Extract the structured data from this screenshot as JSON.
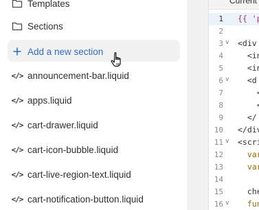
{
  "tree": {
    "templates_label": "Templates",
    "sections_label": "Sections",
    "add_section_label": "Add a new section",
    "file_icon_glyph": "</>",
    "files": [
      "announcement-bar.liquid",
      "apps.liquid",
      "cart-drawer.liquid",
      "cart-icon-bubble.liquid",
      "cart-live-region-text.liquid",
      "cart-notification-button.liquid"
    ]
  },
  "editor": {
    "tab_name": "Current",
    "lines": [
      {
        "num": "1",
        "text": "{{ 'p",
        "fold": "",
        "active": true
      },
      {
        "num": "2",
        "text": "",
        "fold": ""
      },
      {
        "num": "3",
        "text": "<div ",
        "fold": "v"
      },
      {
        "num": "4",
        "text": "  <in",
        "fold": ""
      },
      {
        "num": "5",
        "text": "  <in",
        "fold": ""
      },
      {
        "num": "6",
        "text": "  <d",
        "fold": "v"
      },
      {
        "num": "7",
        "text": "    <",
        "fold": ""
      },
      {
        "num": "8",
        "text": "    <",
        "fold": ""
      },
      {
        "num": "9",
        "text": "  </",
        "fold": ""
      },
      {
        "num": "10",
        "text": "</div",
        "fold": ""
      },
      {
        "num": "11",
        "text": "<scri",
        "fold": "v"
      },
      {
        "num": "12",
        "text": "  var",
        "fold": ""
      },
      {
        "num": "13",
        "text": "  var",
        "fold": ""
      },
      {
        "num": "14",
        "text": "",
        "fold": ""
      },
      {
        "num": "15",
        "text": "  che",
        "fold": ""
      },
      {
        "num": "16",
        "text": "  fun",
        "fold": "v"
      }
    ]
  },
  "colors": {
    "accent": "#2c6ecb",
    "hover_bg": "#f1f1f1",
    "active_line": "#eaf2fc"
  }
}
